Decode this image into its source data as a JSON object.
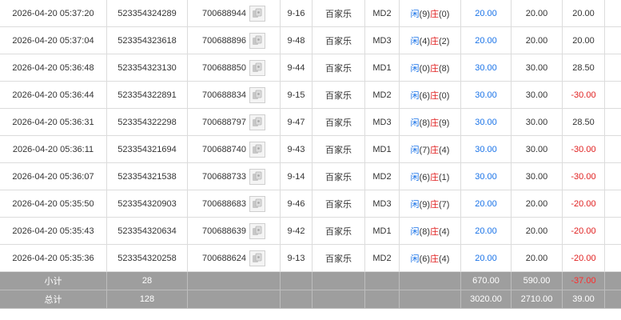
{
  "rows": [
    {
      "time": "2026-04-20 05:37:20",
      "bet_id": "523354324289",
      "round_id": "700688944",
      "table_no": "9-16",
      "game": "百家乐",
      "room": "MD2",
      "result": {
        "player_label": "闲",
        "player_value": "(9)",
        "banker_label": "庄",
        "banker_value": "(0)"
      },
      "bet": "20.00",
      "valid": "20.00",
      "winloss": "20.00",
      "negative": false
    },
    {
      "time": "2026-04-20 05:37:04",
      "bet_id": "523354323618",
      "round_id": "700688896",
      "table_no": "9-48",
      "game": "百家乐",
      "room": "MD3",
      "result": {
        "player_label": "闲",
        "player_value": "(4)",
        "banker_label": "庄",
        "banker_value": "(2)"
      },
      "bet": "20.00",
      "valid": "20.00",
      "winloss": "20.00",
      "negative": false
    },
    {
      "time": "2026-04-20 05:36:48",
      "bet_id": "523354323130",
      "round_id": "700688850",
      "table_no": "9-44",
      "game": "百家乐",
      "room": "MD1",
      "result": {
        "player_label": "闲",
        "player_value": "(0)",
        "banker_label": "庄",
        "banker_value": "(8)"
      },
      "bet": "30.00",
      "valid": "30.00",
      "winloss": "28.50",
      "negative": false
    },
    {
      "time": "2026-04-20 05:36:44",
      "bet_id": "523354322891",
      "round_id": "700688834",
      "table_no": "9-15",
      "game": "百家乐",
      "room": "MD2",
      "result": {
        "player_label": "闲",
        "player_value": "(6)",
        "banker_label": "庄",
        "banker_value": "(0)"
      },
      "bet": "30.00",
      "valid": "30.00",
      "winloss": "-30.00",
      "negative": true
    },
    {
      "time": "2026-04-20 05:36:31",
      "bet_id": "523354322298",
      "round_id": "700688797",
      "table_no": "9-47",
      "game": "百家乐",
      "room": "MD3",
      "result": {
        "player_label": "闲",
        "player_value": "(8)",
        "banker_label": "庄",
        "banker_value": "(9)"
      },
      "bet": "30.00",
      "valid": "30.00",
      "winloss": "28.50",
      "negative": false
    },
    {
      "time": "2026-04-20 05:36:11",
      "bet_id": "523354321694",
      "round_id": "700688740",
      "table_no": "9-43",
      "game": "百家乐",
      "room": "MD1",
      "result": {
        "player_label": "闲",
        "player_value": "(7)",
        "banker_label": "庄",
        "banker_value": "(4)"
      },
      "bet": "30.00",
      "valid": "30.00",
      "winloss": "-30.00",
      "negative": true
    },
    {
      "time": "2026-04-20 05:36:07",
      "bet_id": "523354321538",
      "round_id": "700688733",
      "table_no": "9-14",
      "game": "百家乐",
      "room": "MD2",
      "result": {
        "player_label": "闲",
        "player_value": "(6)",
        "banker_label": "庄",
        "banker_value": "(1)"
      },
      "bet": "30.00",
      "valid": "30.00",
      "winloss": "-30.00",
      "negative": true
    },
    {
      "time": "2026-04-20 05:35:50",
      "bet_id": "523354320903",
      "round_id": "700688683",
      "table_no": "9-46",
      "game": "百家乐",
      "room": "MD3",
      "result": {
        "player_label": "闲",
        "player_value": "(9)",
        "banker_label": "庄",
        "banker_value": "(7)"
      },
      "bet": "20.00",
      "valid": "20.00",
      "winloss": "-20.00",
      "negative": true
    },
    {
      "time": "2026-04-20 05:35:43",
      "bet_id": "523354320634",
      "round_id": "700688639",
      "table_no": "9-42",
      "game": "百家乐",
      "room": "MD1",
      "result": {
        "player_label": "闲",
        "player_value": "(8)",
        "banker_label": "庄",
        "banker_value": "(4)"
      },
      "bet": "20.00",
      "valid": "20.00",
      "winloss": "-20.00",
      "negative": true
    },
    {
      "time": "2026-04-20 05:35:36",
      "bet_id": "523354320258",
      "round_id": "700688624",
      "table_no": "9-13",
      "game": "百家乐",
      "room": "MD2",
      "result": {
        "player_label": "闲",
        "player_value": "(6)",
        "banker_label": "庄",
        "banker_value": "(4)"
      },
      "bet": "20.00",
      "valid": "20.00",
      "winloss": "-20.00",
      "negative": true
    }
  ],
  "subtotal": {
    "label": "小计",
    "count": "28",
    "bet": "670.00",
    "valid": "590.00",
    "winloss": "-37.00",
    "negative": true
  },
  "total": {
    "label": "总计",
    "count": "128",
    "bet": "3020.00",
    "valid": "2710.00",
    "winloss": "39.00",
    "negative": false
  },
  "colors": {
    "player_blue": "#1a73e8",
    "banker_red": "#e02020",
    "summary_bg": "#9e9e9e"
  },
  "icons": {
    "round_thumbnail": "card-image-icon"
  }
}
